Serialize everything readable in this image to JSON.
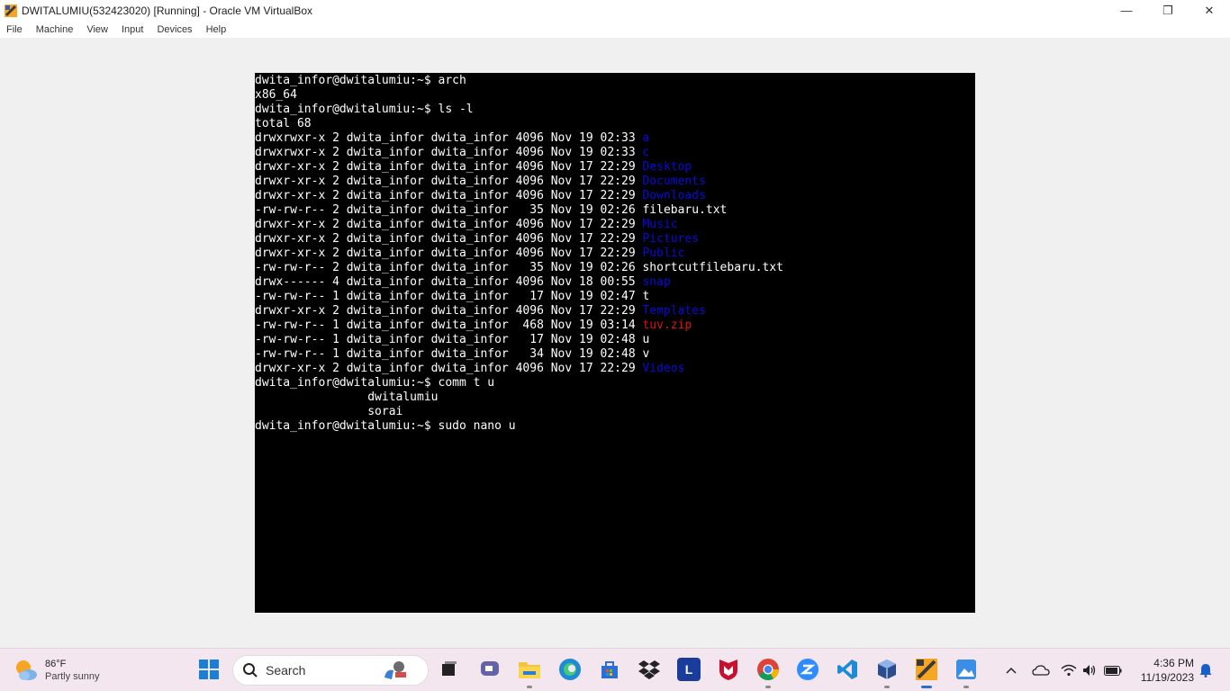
{
  "window": {
    "title": "DWITALUMIU(532423020) [Running] - Oracle VM VirtualBox",
    "minimize": "—",
    "restore": "❐",
    "close": "✕"
  },
  "menu": [
    "File",
    "Machine",
    "View",
    "Input",
    "Devices",
    "Help"
  ],
  "terminal": {
    "lines": [
      {
        "text": "dwita_infor@dwitalumiu:~$ arch"
      },
      {
        "text": "x86_64"
      },
      {
        "text": "dwita_infor@dwitalumiu:~$ ls -l"
      },
      {
        "text": "total 68"
      },
      {
        "text": "drwxrwxr-x 2 dwita_infor dwita_infor 4096 Nov 19 02:33 ",
        "name": "a",
        "kind": "dir"
      },
      {
        "text": "drwxrwxr-x 2 dwita_infor dwita_infor 4096 Nov 19 02:33 ",
        "name": "c",
        "kind": "dir"
      },
      {
        "text": "drwxr-xr-x 2 dwita_infor dwita_infor 4096 Nov 17 22:29 ",
        "name": "Desktop",
        "kind": "dir"
      },
      {
        "text": "drwxr-xr-x 2 dwita_infor dwita_infor 4096 Nov 17 22:29 ",
        "name": "Documents",
        "kind": "dir"
      },
      {
        "text": "drwxr-xr-x 2 dwita_infor dwita_infor 4096 Nov 17 22:29 ",
        "name": "Downloads",
        "kind": "dir"
      },
      {
        "text": "-rw-rw-r-- 2 dwita_infor dwita_infor   35 Nov 19 02:26 ",
        "name": "filebaru.txt",
        "kind": "file"
      },
      {
        "text": "drwxr-xr-x 2 dwita_infor dwita_infor 4096 Nov 17 22:29 ",
        "name": "Music",
        "kind": "dir"
      },
      {
        "text": "drwxr-xr-x 2 dwita_infor dwita_infor 4096 Nov 17 22:29 ",
        "name": "Pictures",
        "kind": "dir"
      },
      {
        "text": "drwxr-xr-x 2 dwita_infor dwita_infor 4096 Nov 17 22:29 ",
        "name": "Public",
        "kind": "dir"
      },
      {
        "text": "-rw-rw-r-- 2 dwita_infor dwita_infor   35 Nov 19 02:26 ",
        "name": "shortcutfilebaru.txt",
        "kind": "file"
      },
      {
        "text": "drwx------ 4 dwita_infor dwita_infor 4096 Nov 18 00:55 ",
        "name": "snap",
        "kind": "dir"
      },
      {
        "text": "-rw-rw-r-- 1 dwita_infor dwita_infor   17 Nov 19 02:47 ",
        "name": "t",
        "kind": "file"
      },
      {
        "text": "drwxr-xr-x 2 dwita_infor dwita_infor 4096 Nov 17 22:29 ",
        "name": "Templates",
        "kind": "dir"
      },
      {
        "text": "-rw-rw-r-- 1 dwita_infor dwita_infor  468 Nov 19 03:14 ",
        "name": "tuv.zip",
        "kind": "zip"
      },
      {
        "text": "-rw-rw-r-- 1 dwita_infor dwita_infor   17 Nov 19 02:48 ",
        "name": "u",
        "kind": "file"
      },
      {
        "text": "-rw-rw-r-- 1 dwita_infor dwita_infor   34 Nov 19 02:48 ",
        "name": "v",
        "kind": "file"
      },
      {
        "text": "drwxr-xr-x 2 dwita_infor dwita_infor 4096 Nov 17 22:29 ",
        "name": "Videos",
        "kind": "dir"
      },
      {
        "text": "dwita_infor@dwitalumiu:~$ comm t u"
      },
      {
        "text": "                dwitalumiu"
      },
      {
        "text": "                sorai"
      },
      {
        "text": "dwita_infor@dwitalumiu:~$ sudo nano u"
      }
    ]
  },
  "taskbar": {
    "weather_temp": "86°F",
    "weather_desc": "Partly sunny",
    "search_label": "Search",
    "store_letter": "L",
    "clock_time": "4:36 PM",
    "clock_date": "11/19/2023"
  },
  "colors": {
    "directory": "#0a0ad8",
    "archive": "#e01010",
    "terminal_bg": "#000000",
    "taskbar_bg": "#f3e6ef"
  }
}
